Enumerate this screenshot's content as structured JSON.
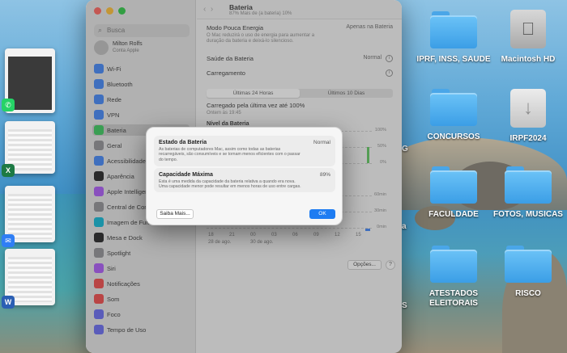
{
  "desktop": {
    "items": [
      {
        "label": "IPRF, INSS, SAUDE",
        "kind": "folder"
      },
      {
        "label": "Macintosh HD",
        "kind": "drive"
      },
      {
        "label": "CONCURSOS",
        "kind": "folder"
      },
      {
        "label": "IRPF2024",
        "kind": "download-drive"
      },
      {
        "label": "FACULDADE",
        "kind": "folder"
      },
      {
        "label": "FOTOS, MUSICAS",
        "kind": "folder"
      },
      {
        "label": "ATESTADOS ELEITORAIS",
        "kind": "folder"
      },
      {
        "label": "RISCO",
        "kind": "folder"
      }
    ],
    "partial_labels": [
      "G",
      "a",
      "S"
    ]
  },
  "settings": {
    "search_placeholder": "Busca",
    "user_name": "Milton Rolfs",
    "user_sub": "Conta Apple",
    "sidebar": [
      "Wi-Fi",
      "Bluetooth",
      "Rede",
      "VPN",
      "Bateria",
      "Geral",
      "Acessibilidade",
      "Aparência",
      "Apple Intelligence",
      "Central de Controle",
      "Imagem de Fundo",
      "Mesa e Dock",
      "Spotlight",
      "Siri",
      "Notificações",
      "Som",
      "Foco",
      "Tempo de Uso"
    ],
    "active_item": "Bateria",
    "window_title": "Bateria",
    "window_subtitle": "87% Mais de (a bateria) 10%",
    "low_power_label": "Modo Pouca Energia",
    "low_power_value": "Apenas na Bateria",
    "low_power_desc": "O Mac reduzirá o uso de energia para aumentar a duração da bateria e deixá-lo silencioso.",
    "health_label": "Saúde da Bateria",
    "health_value": "Normal",
    "charging_label": "Carregamento",
    "tab_24h": "Últimas 24 Horas",
    "tab_10d": "Últimos 10 Dias",
    "last_charge": "Carregado pela última vez até 100%",
    "last_charge_time": "Ontem às 19:45",
    "level_label": "Nível da Bateria",
    "y_labels": [
      "100%",
      "50%",
      "0%",
      "60min",
      "30min",
      "0min"
    ],
    "x_labels": [
      "18",
      "21",
      "00",
      "03",
      "06",
      "09",
      "12",
      "15"
    ],
    "date_labels": [
      "28 de ago.",
      "30 de ago."
    ],
    "options_button": "Opções...",
    "help_button": "?"
  },
  "modal": {
    "card1_title": "Estado da Bateria",
    "card1_value": "Normal",
    "card1_desc": "As baterias de computadores Mac, assim como todas as baterias recarregáveis, são consumíveis e se tornam menos eficientes com o passar do tempo.",
    "card2_title": "Capacidade Máxima",
    "card2_value": "89%",
    "card2_desc": "Esta é uma medida da capacidade da bateria relativa a quando era nova. Uma capacidade menor pode resultar em menos horas de uso entre cargas.",
    "more_button": "Saiba Mais...",
    "ok_button": "OK"
  }
}
